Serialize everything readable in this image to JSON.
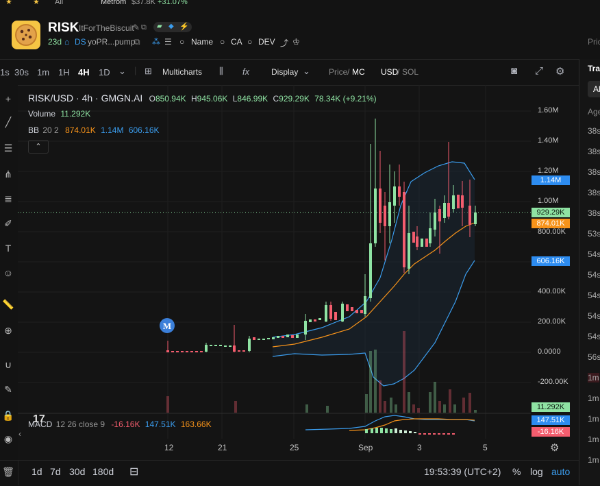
{
  "top_strip": {
    "tab": "All",
    "ticker": "Metrom",
    "mc": "$37.8K",
    "change": "+31.07%"
  },
  "token": {
    "ticker": "RISK",
    "name": "ItForTheBiscuit",
    "age": "23d",
    "ds": "DS",
    "address": "yoPR...pump",
    "name_link": "Name",
    "ca_link": "CA",
    "dev_link": "DEV",
    "price_label": "Pric"
  },
  "toolbar": {
    "intervals": [
      "1s",
      "30s",
      "1m",
      "1H",
      "4H",
      "1D"
    ],
    "active_interval": "4H",
    "multicharts": "Multicharts",
    "display": "Display",
    "price": "Price",
    "mc": "MC",
    "usd": "USD",
    "sol": "SOL"
  },
  "legend": {
    "pair": "RISK/USD · 4h · GMGN.AI",
    "o_label": "O",
    "o_value": "850.94K",
    "h_label": "H",
    "h_value": "945.06K",
    "l_label": "L",
    "l_value": "846.99K",
    "c_label": "C",
    "c_value": "929.29K",
    "change": "78.34K (+9.21%)",
    "volume_label": "Volume",
    "volume_value": "11.292K",
    "bb_label": "BB",
    "bb_params": "20 2",
    "bb_mid": "874.01K",
    "bb_upper": "1.14M",
    "bb_lower": "606.16K",
    "macd_label": "MACD",
    "macd_params": "12 26 close 9",
    "macd_hist": "-16.16K",
    "macd_line": "147.51K",
    "macd_signal": "163.66K",
    "marker": "M"
  },
  "price_tags": {
    "upper": "1.14M",
    "last": "929.29K",
    "mid": "874.01K",
    "lower": "606.16K",
    "volume": "11.292K",
    "macd": "147.51K",
    "hist": "-16.16K"
  },
  "colors": {
    "up": "#8fe3a3",
    "down": "#f45d6e",
    "bb_upper": "#3b9dee",
    "bb_mid": "#f7931a",
    "tag_blue": "#2d8cf0",
    "tag_orange": "#f7931a",
    "tag_green": "#8fe3a3",
    "tag_red": "#f45d6e"
  },
  "chart_data": {
    "type": "candlestick",
    "title": "RISK/USD · 4h · GMGN.AI",
    "y_ticks": [
      "1.60M",
      "1.40M",
      "1.20M",
      "1.00M",
      "800.00K",
      "400.00K",
      "200.00K",
      "0.0000",
      "-200.00K"
    ],
    "x_ticks": [
      "12",
      "21",
      "25",
      "Sep",
      "3",
      "5"
    ],
    "ylim": [
      -200000,
      1600000
    ],
    "last_close": 929290,
    "series": [
      {
        "name": "Upper",
        "values": [
          1140000
        ]
      },
      {
        "name": "Basis",
        "values": [
          874010
        ]
      },
      {
        "name": "Lower",
        "values": [
          606160
        ]
      }
    ],
    "volume": 11292,
    "macd": {
      "line": 147510,
      "signal": 163660,
      "hist": -16160
    }
  },
  "bottom": {
    "ranges": [
      "1d",
      "7d",
      "30d",
      "180d"
    ],
    "time": "19:53:39 (UTC+2)",
    "pct": "%",
    "log": "log",
    "auto": "auto"
  },
  "right_panel": {
    "title": "Trad",
    "tab": "All",
    "col": "Age",
    "rows": [
      "38s",
      "38s",
      "38s",
      "38s",
      "38s",
      "53s",
      "54s",
      "54s",
      "54s",
      "54s",
      "54s",
      "56s",
      "1m",
      "1m",
      "1m",
      "1m",
      "1m"
    ]
  }
}
